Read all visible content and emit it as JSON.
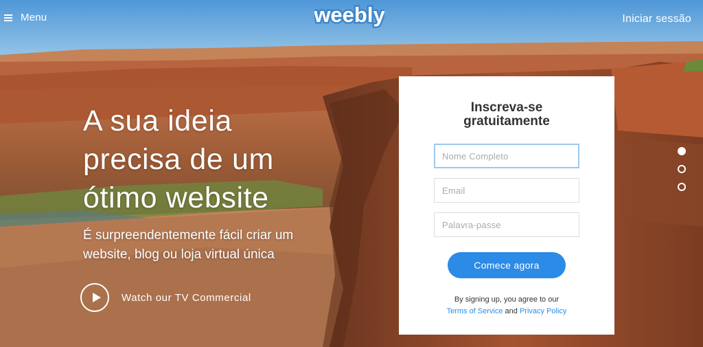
{
  "header": {
    "menu_label": "Menu",
    "logo_text": "weebly",
    "login_label": "Iniciar sessão"
  },
  "hero": {
    "title_lines": [
      "A sua ideia",
      "precisa de um",
      "ótimo website"
    ],
    "subtitle_lines": [
      "É surpreendentemente fácil criar um",
      "website, blog ou loja virtual única"
    ],
    "watch_label": "Watch our TV Commercial"
  },
  "signup": {
    "heading_lines": [
      "Inscreva-se",
      "gratuitamente"
    ],
    "name_placeholder": "Nome Completo",
    "email_placeholder": "Email",
    "password_placeholder": "Palavra-passe",
    "cta_label": "Comece agora",
    "terms_prefix": "By signing up, you agree to our",
    "terms_link": "Terms of Service",
    "terms_and": "and",
    "privacy_link": "Privacy Policy"
  },
  "slider": {
    "active_index": 0,
    "count": 3
  },
  "colors": {
    "accent": "#2b8be7",
    "sky": "#6aa9d8",
    "rock": "#a4532f",
    "focus_border": "#9cc8ee"
  },
  "icons": {
    "menu": "hamburger-icon",
    "play": "play-icon"
  }
}
